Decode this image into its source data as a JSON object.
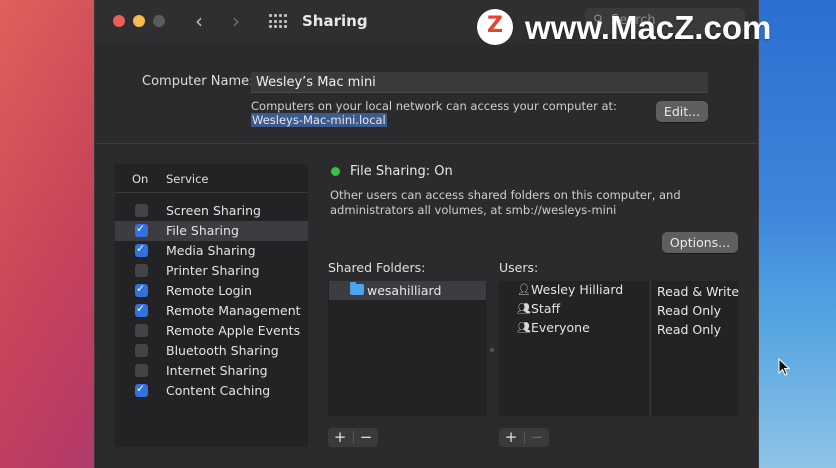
{
  "window": {
    "title": "Sharing",
    "search_placeholder": "Search"
  },
  "computer_name": {
    "label": "Computer Name:",
    "value": "Wesley’s Mac mini",
    "description": "Computers on your local network can access your computer at:",
    "address": "Wesleys-Mac-mini.local",
    "edit_label": "Edit..."
  },
  "services": {
    "header_on": "On",
    "header_service": "Service",
    "items": [
      {
        "label": "Screen Sharing",
        "on": false,
        "selected": false
      },
      {
        "label": "File Sharing",
        "on": true,
        "selected": true
      },
      {
        "label": "Media Sharing",
        "on": true,
        "selected": false
      },
      {
        "label": "Printer Sharing",
        "on": false,
        "selected": false
      },
      {
        "label": "Remote Login",
        "on": true,
        "selected": false
      },
      {
        "label": "Remote Management",
        "on": true,
        "selected": false
      },
      {
        "label": "Remote Apple Events",
        "on": false,
        "selected": false
      },
      {
        "label": "Bluetooth Sharing",
        "on": false,
        "selected": false
      },
      {
        "label": "Internet Sharing",
        "on": false,
        "selected": false
      },
      {
        "label": "Content Caching",
        "on": true,
        "selected": false
      }
    ]
  },
  "detail": {
    "status": "File Sharing: On",
    "status_color": "#37c345",
    "description": "Other users can access shared folders on this computer, and administrators all volumes, at smb://wesleys-mini",
    "options_label": "Options...",
    "shared_folders_label": "Shared Folders:",
    "users_label": "Users:",
    "shared_folders": [
      "wesahilliard"
    ],
    "users": [
      {
        "name": "Wesley Hilliard",
        "icon": "person-icon",
        "permission": "Read & Write"
      },
      {
        "name": "Staff",
        "icon": "group-icon",
        "permission": "Read Only"
      },
      {
        "name": "Everyone",
        "icon": "group-icon",
        "permission": "Read Only"
      }
    ],
    "add_symbol": "+",
    "remove_symbol": "−"
  },
  "watermark": {
    "text": "www.MacZ.com"
  }
}
